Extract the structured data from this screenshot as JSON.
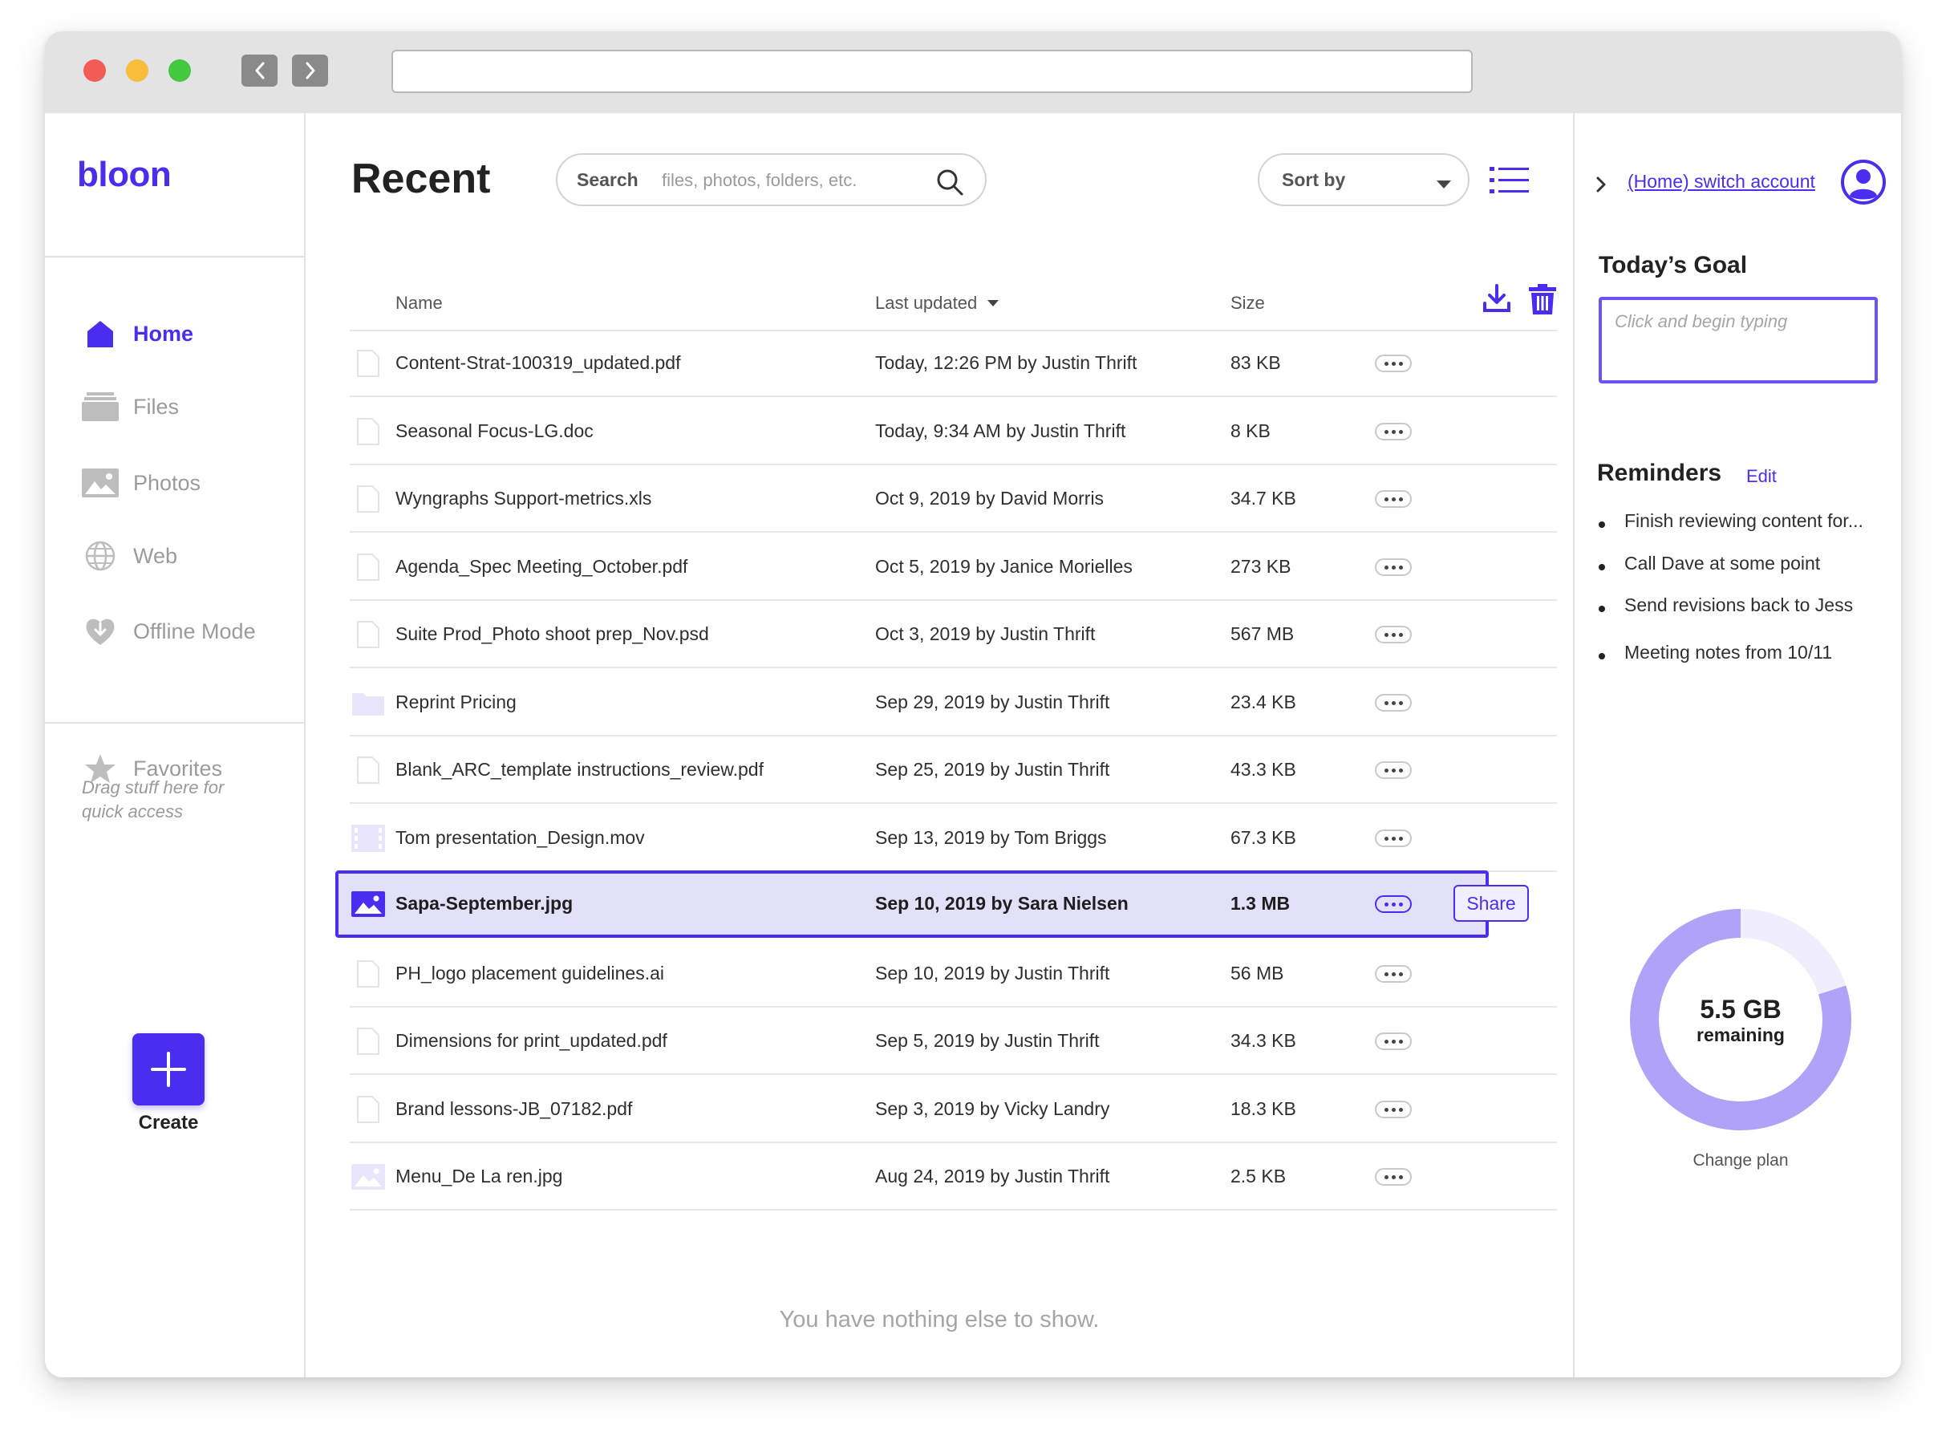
{
  "app": {
    "logo": "bloon"
  },
  "sidebar": {
    "items": [
      {
        "label": "Home",
        "icon": "home-icon",
        "active": true
      },
      {
        "label": "Files",
        "icon": "files-icon",
        "active": false
      },
      {
        "label": "Photos",
        "icon": "photos-icon",
        "active": false
      },
      {
        "label": "Web",
        "icon": "globe-icon",
        "active": false
      },
      {
        "label": "Offline Mode",
        "icon": "offline-heart-icon",
        "active": false
      }
    ],
    "favorites": {
      "label": "Favorites",
      "hint": "Drag stuff here for quick access"
    },
    "create_label": "Create"
  },
  "main": {
    "title": "Recent",
    "search": {
      "label": "Search",
      "placeholder": "files, photos, folders, etc."
    },
    "sort": {
      "label": "Sort by"
    },
    "columns": {
      "name": "Name",
      "updated": "Last updated",
      "size": "Size"
    },
    "files": [
      {
        "name": "Content-Strat-100319_updated.pdf",
        "updated": "Today, 12:26 PM by Justin Thrift",
        "size": "83 KB",
        "type": "doc"
      },
      {
        "name": "Seasonal Focus-LG.doc",
        "updated": "Today, 9:34 AM by Justin Thrift",
        "size": "8 KB",
        "type": "doc"
      },
      {
        "name": "Wyngraphs Support-metrics.xls",
        "updated": "Oct 9, 2019 by David Morris",
        "size": "34.7 KB",
        "type": "doc"
      },
      {
        "name": "Agenda_Spec Meeting_October.pdf",
        "updated": "Oct 5, 2019 by Janice Morielles",
        "size": "273 KB",
        "type": "doc"
      },
      {
        "name": "Suite Prod_Photo shoot prep_Nov.psd",
        "updated": "Oct 3, 2019 by Justin Thrift",
        "size": "567 MB",
        "type": "doc"
      },
      {
        "name": "Reprint Pricing",
        "updated": "Sep 29, 2019 by Justin Thrift",
        "size": "23.4 KB",
        "type": "folder"
      },
      {
        "name": "Blank_ARC_template instructions_review.pdf",
        "updated": "Sep 25, 2019 by Justin Thrift",
        "size": "43.3 KB",
        "type": "doc"
      },
      {
        "name": "Tom presentation_Design.mov",
        "updated": "Sep 13, 2019 by Tom Briggs",
        "size": "67.3 KB",
        "type": "video"
      },
      {
        "name": "Sapa-September.jpg",
        "updated": "Sep 10, 2019 by Sara Nielsen",
        "size": "1.3 MB",
        "type": "image",
        "selected": true
      },
      {
        "name": "PH_logo placement guidelines.ai",
        "updated": "Sep 10, 2019 by Justin Thrift",
        "size": "56 MB",
        "type": "doc"
      },
      {
        "name": "Dimensions for print_updated.pdf",
        "updated": "Sep 5, 2019 by Justin Thrift",
        "size": "34.3 KB",
        "type": "doc"
      },
      {
        "name": "Brand lessons-JB_07182.pdf",
        "updated": "Sep 3, 2019 by Vicky Landry",
        "size": "18.3 KB",
        "type": "doc"
      },
      {
        "name": "Menu_De La ren.jpg",
        "updated": "Aug 24, 2019 by Justin Thrift",
        "size": "2.5 KB",
        "type": "image"
      }
    ],
    "share_label": "Share",
    "empty_message": "You have nothing else to show."
  },
  "right": {
    "account_link": "(Home) switch account",
    "goal": {
      "title": "Today’s Goal",
      "placeholder": "Click and begin typing"
    },
    "reminders": {
      "title": "Reminders",
      "edit_label": "Edit",
      "items": [
        "Finish reviewing content for...",
        "Call Dave at some point",
        "Send revisions back to Jess",
        "Meeting notes from 10/11"
      ]
    },
    "storage": {
      "value": "5.5 GB",
      "label": "remaining",
      "remaining_fraction": 0.8,
      "change_plan": "Change plan"
    }
  },
  "colors": {
    "accent": "#4a2ef0",
    "selected_row_bg": "#e3e0fa",
    "storage_ring": "#b0a2f7",
    "muted_icon": "#e9e6fc"
  }
}
